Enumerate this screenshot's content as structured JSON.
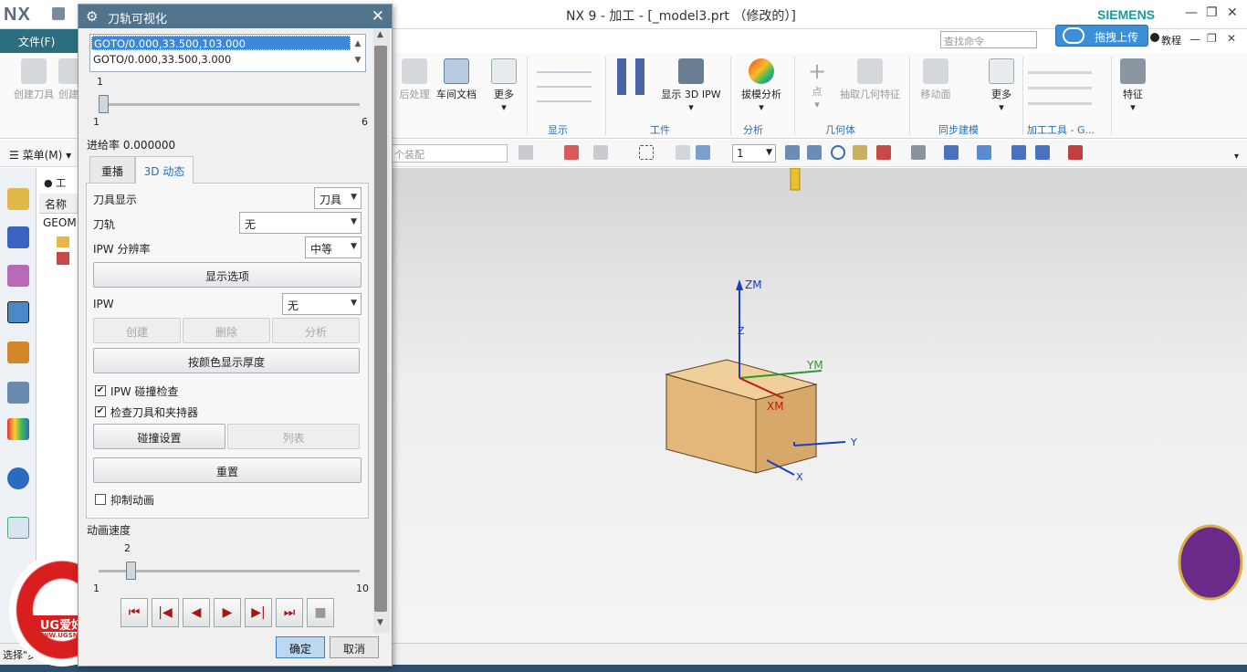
{
  "app": {
    "logo": "NX",
    "window_title": "NX 9 - 加工 - [_model3.prt （修改的）]",
    "brand": "SIEMENS",
    "menu_file": "文件(F)",
    "search_placeholder": "查找命令",
    "upload_label": "拖拽上传",
    "tutorial": "教程"
  },
  "ribbon": {
    "left_items": [
      "创建刀具",
      "创建"
    ],
    "items": [
      "后处理",
      "车间文档",
      "更多",
      "显示 3D IPW",
      "拔模分析",
      "点",
      "抽取几何特征",
      "移动面",
      "更多",
      "特征"
    ],
    "groups": [
      "显示",
      "工件",
      "分析",
      "几何体",
      "同步建模",
      "加工工具 - G..."
    ]
  },
  "toolbar2": {
    "menu": "菜单(M)",
    "assembly_placeholder": "个装配",
    "layer_value": "1"
  },
  "navigator": {
    "header": "工",
    "col_name": "名称",
    "row_geom": "GEOM"
  },
  "dialog": {
    "title": "刀轨可视化",
    "list": [
      "GOTO/0.000,33.500,103.000",
      "GOTO/0.000,33.500,3.000"
    ],
    "slider1": {
      "current": "1",
      "min": "1",
      "max": "6",
      "position": 0.0
    },
    "feed_rate_label": "进给率",
    "feed_rate_value": "0.000000",
    "tabs": [
      "重播",
      "3D 动态"
    ],
    "tool_display_label": "刀具显示",
    "tool_display_value": "刀具",
    "toolpath_label": "刀轨",
    "toolpath_value": "无",
    "ipw_res_label": "IPW 分辨率",
    "ipw_res_value": "中等",
    "display_options": "显示选项",
    "ipw_label": "IPW",
    "ipw_value": "无",
    "create": "创建",
    "delete": "删除",
    "analyze": "分析",
    "color_thickness": "按颜色显示厚度",
    "ipw_collision": "IPW 碰撞检查",
    "check_tool": "检查刀具和夹持器",
    "collision_settings": "碰撞设置",
    "list_button": "列表",
    "reset": "重置",
    "suppress_anim": "抑制动画",
    "anim_speed_label": "动画速度",
    "slider2": {
      "current": "2",
      "min": "1",
      "max": "10",
      "position": 0.11
    },
    "ok": "确定",
    "cancel": "取消"
  },
  "viewport": {
    "axes": {
      "zm": "ZM",
      "ym": "YM",
      "xm": "XM",
      "z": "Z",
      "y": "Y",
      "x": "X"
    }
  },
  "status": {
    "text": "选择\"步骤\"或\"播",
    "watermark_text": "UG爱好者",
    "watermark_url": "WWW.UGSNX.COM"
  },
  "colors": {
    "dialog_title": "#52738c",
    "file_menu": "#2c6e80",
    "block": "#e3b67a",
    "accent": "#3b88d8"
  }
}
